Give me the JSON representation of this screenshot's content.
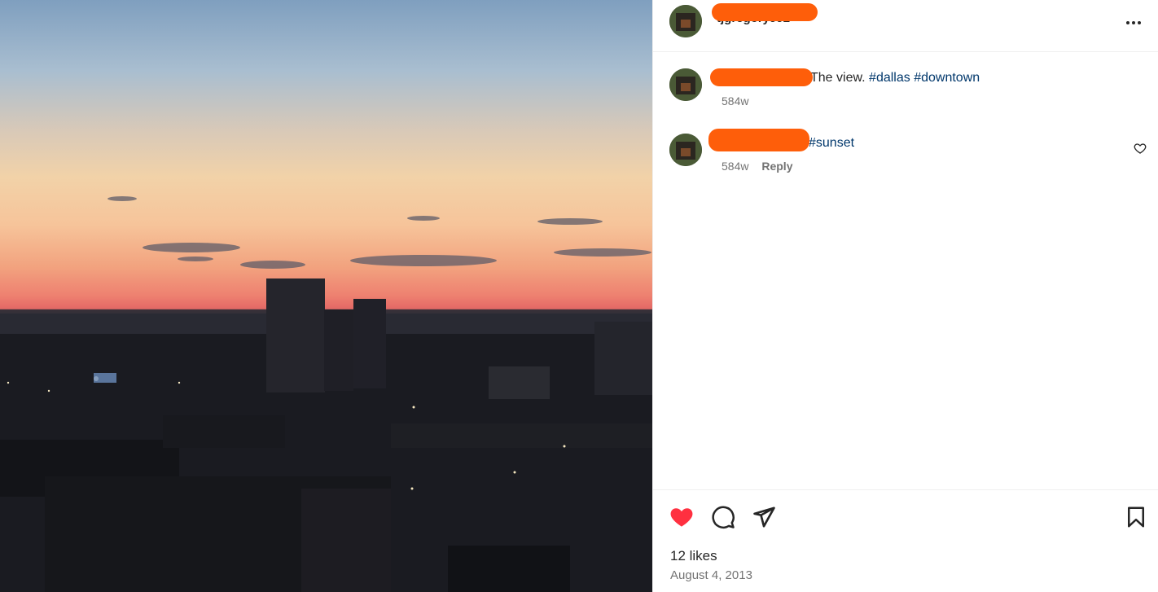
{
  "post": {
    "username": "tjgregory992",
    "icons": {
      "more": "more-horizontal-icon",
      "like": "heart-filled-icon",
      "comment": "comment-icon",
      "share": "send-icon",
      "save": "bookmark-icon",
      "comment_like": "heart-outline-icon"
    },
    "colors": {
      "redaction": "#fe5e0a",
      "like_active": "#ff3040",
      "hashtag": "#00376b"
    }
  },
  "comments": [
    {
      "text": "The view.",
      "tags": [
        "#dallas",
        "#downtown"
      ],
      "age": "584w"
    },
    {
      "text": "",
      "tags": [
        "#sunset"
      ],
      "age": "584w",
      "reply_label": "Reply"
    }
  ],
  "footer": {
    "likes": "12 likes",
    "date": "August 4, 2013"
  }
}
